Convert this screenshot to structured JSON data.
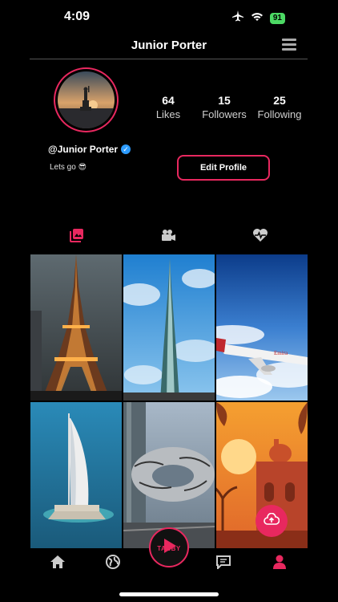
{
  "status": {
    "time": "4:09",
    "battery": "91"
  },
  "header": {
    "title": "Junior Porter"
  },
  "profile": {
    "handle": "@Junior Porter",
    "bio": "Lets go 😎",
    "stats": [
      {
        "value": "64",
        "label": "Likes"
      },
      {
        "value": "15",
        "label": "Followers"
      },
      {
        "value": "25",
        "label": "Following"
      }
    ],
    "edit_label": "Edit Profile"
  },
  "tabs": [
    {
      "icon": "photos-icon",
      "active": true
    },
    {
      "icon": "videos-icon",
      "active": false
    },
    {
      "icon": "liked-icon",
      "active": false
    }
  ],
  "grid": [
    {
      "subject": "eiffel-tower"
    },
    {
      "subject": "burj-khalifa"
    },
    {
      "subject": "airplane-above-clouds"
    },
    {
      "subject": "burj-al-arab"
    },
    {
      "subject": "museum-of-the-future"
    },
    {
      "subject": "mosque-sunset-illustration"
    }
  ],
  "bottom_nav": {
    "items": [
      "home-icon",
      "globe-icon",
      "chat-icon",
      "profile-icon"
    ],
    "center_logo_text": "TABBY"
  },
  "colors": {
    "accent": "#e8285f",
    "background": "#000000",
    "verified": "#2d9cff"
  }
}
